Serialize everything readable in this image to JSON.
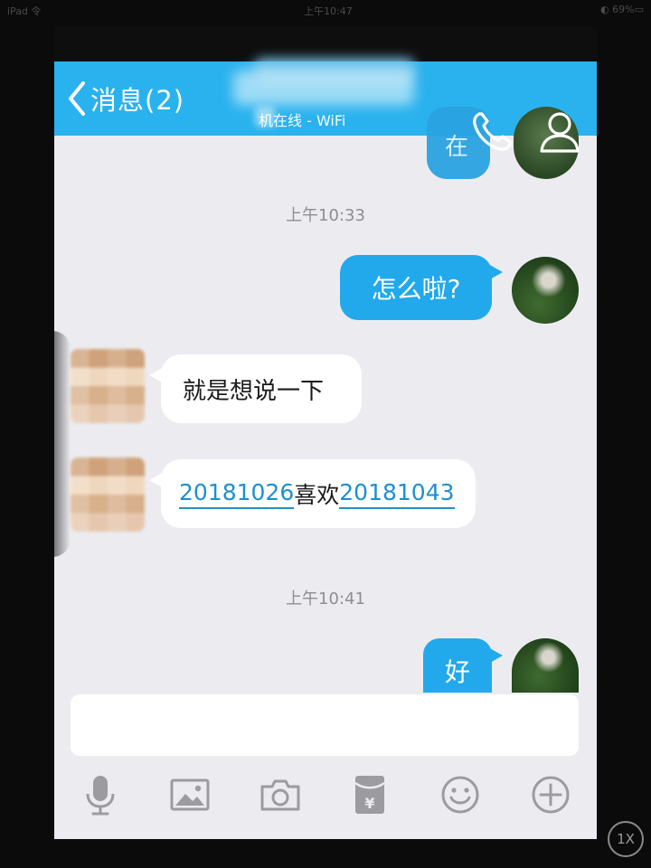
{
  "status_bar": {
    "left": "iPad 令",
    "center": "上午10:47",
    "right": "◐ 69%▭"
  },
  "nav": {
    "back_label": "消息(2)",
    "subtitle": "机在线 - WiFi",
    "behind_bubble_text": "在"
  },
  "messages": {
    "time_1": "上午10:33",
    "out_1": "怎么啦?",
    "in_1": "就是想说一下",
    "in_2_part_a": "20181026",
    "in_2_part_b": "喜欢",
    "in_2_part_c": "20181043",
    "time_2": "上午10:41",
    "out_2": "好"
  },
  "input": {
    "value": ""
  },
  "toolbar": {
    "icons": [
      "microphone-icon",
      "image-icon",
      "camera-icon",
      "red-packet-icon",
      "emoji-icon",
      "plus-icon"
    ]
  },
  "overlay": {
    "zoom_label": "1X"
  },
  "colors": {
    "nav": "#2ab2ee",
    "bubble_out": "#22a9ec",
    "link": "#1e8fd0",
    "background": "#ececf0"
  }
}
